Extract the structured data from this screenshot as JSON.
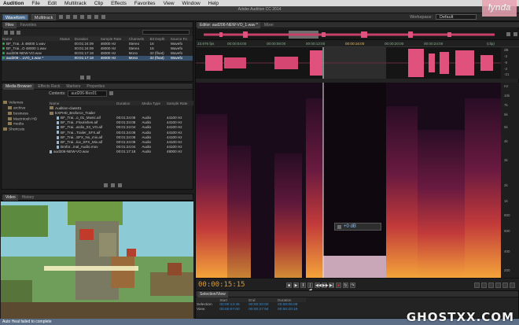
{
  "menu": {
    "app": "Audition",
    "items": [
      "File",
      "Edit",
      "Multitrack",
      "Clip",
      "Effects",
      "Favorites",
      "View",
      "Window",
      "Help"
    ]
  },
  "window_title": "Adobe Audition CC 2014",
  "toolbar": {
    "waveform": "Waveform",
    "multitrack": "Multitrack",
    "workspace_label": "Workspace:",
    "workspace_value": "Default"
  },
  "files_panel": {
    "tabs": [
      "Files",
      "Favorites"
    ],
    "columns": [
      "Name",
      "Status",
      "Duration",
      "Sample Rate",
      "Channels",
      "Bit Depth",
      "Source Fo"
    ],
    "rows": [
      [
        "BF_Trai...k 48000 1.wav",
        "",
        "00:01:24:09",
        "48000 Hz",
        "Stereo",
        "16",
        "Wavefo"
      ],
      [
        "BF_Trai...O 48000 1.wav",
        "",
        "00:01:24:09",
        "48000 Hz",
        "Stereo",
        "16",
        "Wavefo"
      ],
      [
        "aud206-NEW-VO.wav",
        "",
        "00:01:17:18",
        "48000 Hz",
        "Mono",
        "32 (float)",
        "Wavefo"
      ],
      [
        "aud206-...LVO_1.wav *",
        "",
        "00:01:17:18",
        "48000 Hz",
        "Mono",
        "32 (float)",
        "Wavefo"
      ]
    ]
  },
  "media_panel": {
    "tabs": [
      "Media Browser",
      "Effects Rack",
      "Markers",
      "Properties"
    ],
    "contents_label": "Contents:",
    "contents_value": "aud206-files01",
    "tree": [
      "Volumes",
      "archive",
      "business",
      "Macintosh HD",
      "media",
      "Shortcuts"
    ],
    "columns": [
      "Name",
      "Duration",
      "Media Type",
      "Sample Rate"
    ],
    "rows": [
      [
        "Audition-class01",
        "",
        "",
        ""
      ],
      [
        "EXPHD_Broforce_Trailer",
        "",
        "",
        ""
      ],
      [
        "BF_Trai...o_01_Music.aif",
        "00:01:24:08",
        "Audio",
        "44100 Hz"
      ],
      [
        "BF_Trai...Flourishes.aif",
        "00:01:24:08",
        "Audio",
        "44100 Hz"
      ],
      [
        "BF_Trai...ardio_03_VO.aif",
        "00:01:24:04",
        "Audio",
        "44100 Hz"
      ],
      [
        "BF_Trai...Trailer_SFX.aif",
        "00:01:24:08",
        "Audio",
        "44100 Hz"
      ],
      [
        "BF_Trai...SFX_No_mix.aif",
        "00:01:24:08",
        "Audio",
        "44100 Hz"
      ],
      [
        "BF_Trai...lux_SFX_Mix.aif",
        "00:01:24:08",
        "Audio",
        "44100 Hz"
      ],
      [
        "Brofor...inal_Audio.mov",
        "00:01:24:04",
        "Audio",
        "44100 Hz"
      ],
      [
        "aud206-NEW-VO.wav",
        "00:01:17:18",
        "Audio",
        "48000 Hz"
      ]
    ]
  },
  "video_panel": {
    "tabs": [
      "Video",
      "History"
    ]
  },
  "editor": {
    "tabs": [
      "Editor: aud206-NEW-VO_1.wav *",
      "Mixer"
    ],
    "ruler_start": "23.976 fps",
    "ruler_marks": [
      "00:00:04:00",
      "00:00:08:00",
      "00:00:12:00",
      "00:00:16:00",
      "00:00:20:00",
      "00:00:24:00"
    ],
    "clip_label": "(clip)",
    "db_scale": [
      "dB",
      "-3",
      "-9",
      "-3",
      "-21"
    ],
    "hz_scale": [
      "Hz",
      "10k",
      "7k",
      "6k",
      "5k",
      "4k",
      "3k",
      "2k",
      "1k",
      "800",
      "600",
      "400",
      "200",
      "100"
    ],
    "hud_value": "+0 dB",
    "current_time": "00:00:15:15"
  },
  "selection_view": {
    "title": "Selection/View",
    "columns": [
      "",
      "Start",
      "End",
      "Duration"
    ],
    "rows": [
      [
        "Selection",
        "00:00:13:45",
        "00:00:20:00",
        "00:00:06:08"
      ],
      [
        "View",
        "00:00:07:00",
        "00:00:27:94",
        "00:00:20:19"
      ]
    ]
  },
  "status": "Auto Heal failed to complete",
  "watermark": "GHOSTXX.COM",
  "logo_text": "lynda",
  "colors": {
    "waveform": "#e0517e",
    "timecode": "#d99a36",
    "selection": "#37506b",
    "ruler_text": "#88b38d"
  }
}
